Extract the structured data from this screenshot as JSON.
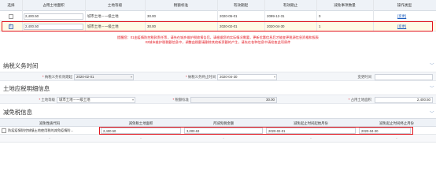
{
  "top_table": {
    "headers": [
      "选择",
      "占用土地面积",
      "土地等级",
      "税额标准",
      "有效期起",
      "有效期止",
      "减免事项数量",
      "操作类型"
    ],
    "rows": [
      {
        "area": "2,400.50",
        "grade": "城市土地－一级土地",
        "tax_rate": "30.00",
        "start": "2020-05-01",
        "end": "2099-12-31",
        "count": "0",
        "action": "[变更]"
      },
      {
        "area": "2,400.50",
        "grade": "城市土地－一级土地",
        "tax_rate": "30.00",
        "start": "2020-02-01",
        "end": "2020-04-30",
        "count": "1",
        "action": "[变更]"
      }
    ]
  },
  "warning": {
    "line1": "提醒您：01由疫情防控税款责任等，请先在城乡维护税收报告后，请根据您的实际情况需要，更新优惠信息后才能变更税源信息资格和报表",
    "line2": "02城市维护税税额信息中，调整由税额请删除其他新资额的产生，请先在各种信息中请检查此项原件"
  },
  "section_tax_period": {
    "title": "纳税义务时间",
    "start_label": "纳税义务有效期起",
    "start_value": "2020-02-01",
    "end_label": "纳税义务终止时间",
    "end_value": "2020-04-30",
    "change_label": "变更时间",
    "change_value": ""
  },
  "section_land": {
    "title": "土地应税明细信息",
    "grade_label": "土地等级",
    "grade_value": "城市土地－一级土地",
    "rate_label": "税额标准",
    "rate_value": "30.00",
    "area_label": "占用土地面积",
    "area_value": "2,400.50"
  },
  "section_relief": {
    "title": "减免税信息",
    "headers": [
      "减免性质代码",
      "减免税土地面积",
      "月减免税金额",
      "减免起止时间起始月份",
      "减免起止时间终止月份"
    ],
    "row1": {
      "code": "防疫疫情防控城镇土地使用税的减免疫情防...",
      "area": "2,400.50",
      "amount": "3,000.63",
      "start": "2020-02-01",
      "end": "2020-04-30"
    },
    "row2": [
      "-",
      "-",
      "-",
      "-",
      "-"
    ]
  },
  "icons": {
    "chevron": "chevron-down-icon",
    "calendar": "calendar-icon",
    "expand": "plus-icon"
  },
  "colors": {
    "highlight": "#e2141d",
    "header_bg": "#eef2f7",
    "link": "#1f5fbf"
  }
}
